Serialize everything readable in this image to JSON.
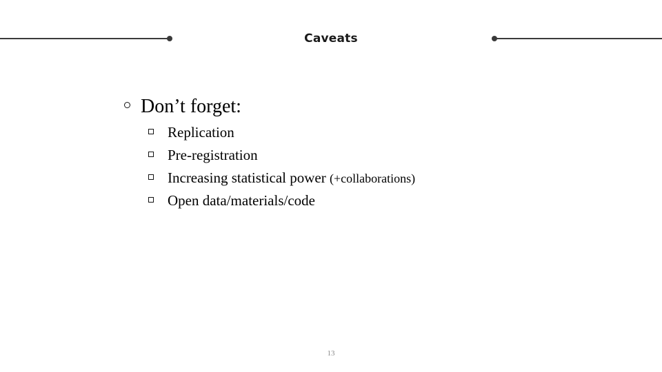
{
  "slide": {
    "title": "Caveats",
    "page_number": "13",
    "accent_color": "#3a3a3a",
    "text_color": "#000000",
    "page_number_color": "#8a8a8a",
    "background_color": "#ffffff"
  },
  "content": {
    "heading": {
      "bullet": "hollow-circle",
      "text": "Don’t forget:"
    },
    "items": [
      {
        "bullet": "hollow-square",
        "text": "Replication",
        "small_suffix": ""
      },
      {
        "bullet": "hollow-square",
        "text": "Pre-registration",
        "small_suffix": ""
      },
      {
        "bullet": "hollow-square",
        "text": "Increasing statistical power ",
        "small_suffix": "(+collaborations)"
      },
      {
        "bullet": "hollow-square",
        "text": "Open data/materials/code",
        "small_suffix": ""
      }
    ]
  }
}
